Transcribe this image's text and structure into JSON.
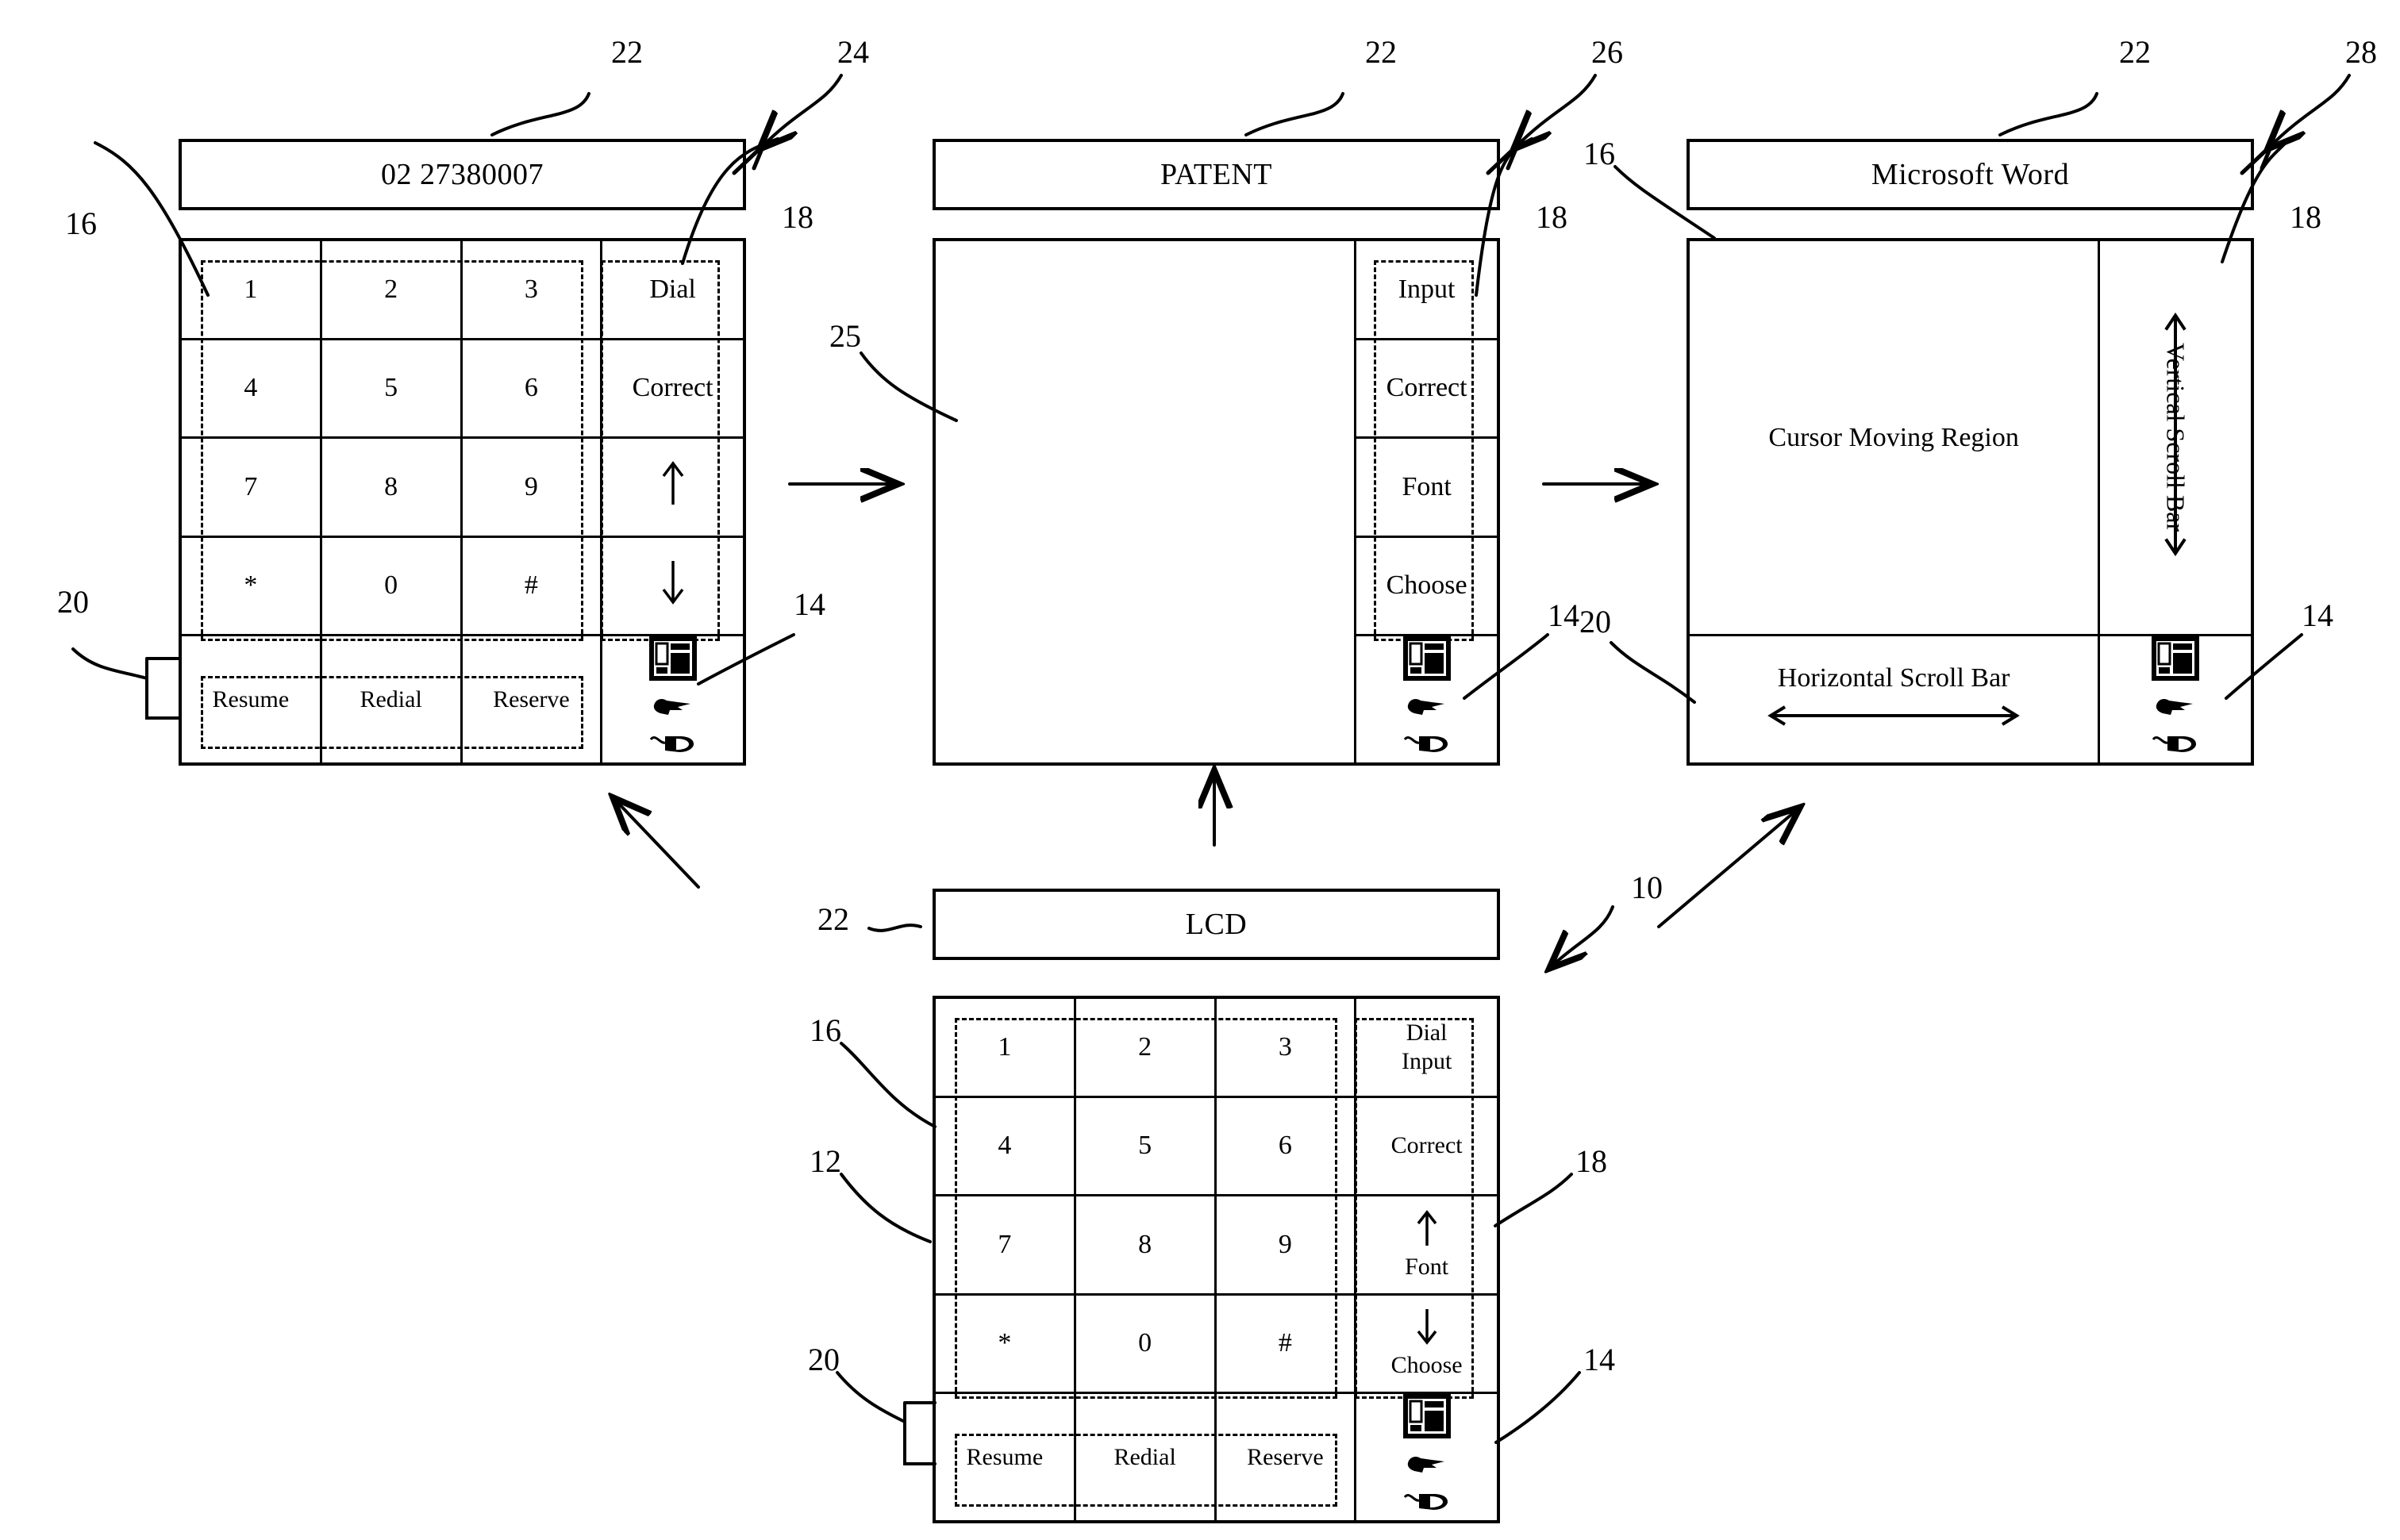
{
  "figure": {
    "type": "patent-figure",
    "reference_numerals": [
      {
        "id": "22a",
        "label": "22"
      },
      {
        "id": "24",
        "label": "24"
      },
      {
        "id": "16a",
        "label": "16"
      },
      {
        "id": "18a",
        "label": "18"
      },
      {
        "id": "20a",
        "label": "20"
      },
      {
        "id": "14a",
        "label": "14"
      },
      {
        "id": "22b",
        "label": "22"
      },
      {
        "id": "26",
        "label": "26"
      },
      {
        "id": "18b",
        "label": "18"
      },
      {
        "id": "25",
        "label": "25"
      },
      {
        "id": "14b",
        "label": "14"
      },
      {
        "id": "22c",
        "label": "22"
      },
      {
        "id": "28",
        "label": "28"
      },
      {
        "id": "16c",
        "label": "16"
      },
      {
        "id": "18c",
        "label": "18"
      },
      {
        "id": "20c",
        "label": "20"
      },
      {
        "id": "14c",
        "label": "14"
      },
      {
        "id": "10",
        "label": "10"
      },
      {
        "id": "22d",
        "label": "22"
      },
      {
        "id": "16d",
        "label": "16"
      },
      {
        "id": "12",
        "label": "12"
      },
      {
        "id": "18d",
        "label": "18"
      },
      {
        "id": "20d",
        "label": "20"
      },
      {
        "id": "14d",
        "label": "14"
      }
    ]
  },
  "panel_phone": {
    "title": "02 27380007",
    "keys": [
      [
        "1",
        "2",
        "3"
      ],
      [
        "4",
        "5",
        "6"
      ],
      [
        "7",
        "8",
        "9"
      ],
      [
        "*",
        "0",
        "#"
      ]
    ],
    "side_buttons": [
      {
        "label": "Dial",
        "icon": "none"
      },
      {
        "label": "Correct",
        "icon": "none"
      },
      {
        "label": "",
        "icon": "arrow-up-icon"
      },
      {
        "label": "",
        "icon": "arrow-down-icon"
      }
    ],
    "bottom_buttons": [
      "Resume",
      "Redial",
      "Reserve"
    ],
    "device_icons": [
      "telephone-icon",
      "pointing-hand-icon",
      "mouse-icon"
    ]
  },
  "panel_patent": {
    "title": "PATENT",
    "canvas_label": "",
    "side_buttons": [
      {
        "label": "Input"
      },
      {
        "label": "Correct"
      },
      {
        "label": "Font"
      },
      {
        "label": "Choose"
      }
    ],
    "device_icons": [
      "telephone-icon",
      "pointing-hand-icon",
      "mouse-icon"
    ]
  },
  "panel_word": {
    "title": "Microsoft Word",
    "cursor_region_label": "Cursor Moving Region",
    "vertical_scroll_label": "Vertical Scroll Bar",
    "horizontal_scroll_label": "Horizontal Scroll Bar",
    "device_icons": [
      "telephone-icon",
      "pointing-hand-icon",
      "mouse-icon"
    ]
  },
  "panel_lcd": {
    "title": "LCD",
    "keys": [
      [
        "1",
        "2",
        "3"
      ],
      [
        "4",
        "5",
        "6"
      ],
      [
        "7",
        "8",
        "9"
      ],
      [
        "*",
        "0",
        "#"
      ]
    ],
    "side_buttons": [
      {
        "label_top": "Dial",
        "label_bottom": "Input",
        "icon": "none"
      },
      {
        "label_top": "",
        "label_bottom": "Correct",
        "icon": "none"
      },
      {
        "label_top": "",
        "label_bottom": "Font",
        "icon": "arrow-up-icon"
      },
      {
        "label_top": "",
        "label_bottom": "Choose",
        "icon": "arrow-down-icon"
      }
    ],
    "bottom_buttons": [
      "Resume",
      "Redial",
      "Reserve"
    ],
    "device_icons": [
      "telephone-icon",
      "pointing-hand-icon",
      "mouse-icon"
    ]
  },
  "colors": {
    "ink": "#000000",
    "paper": "#ffffff"
  }
}
